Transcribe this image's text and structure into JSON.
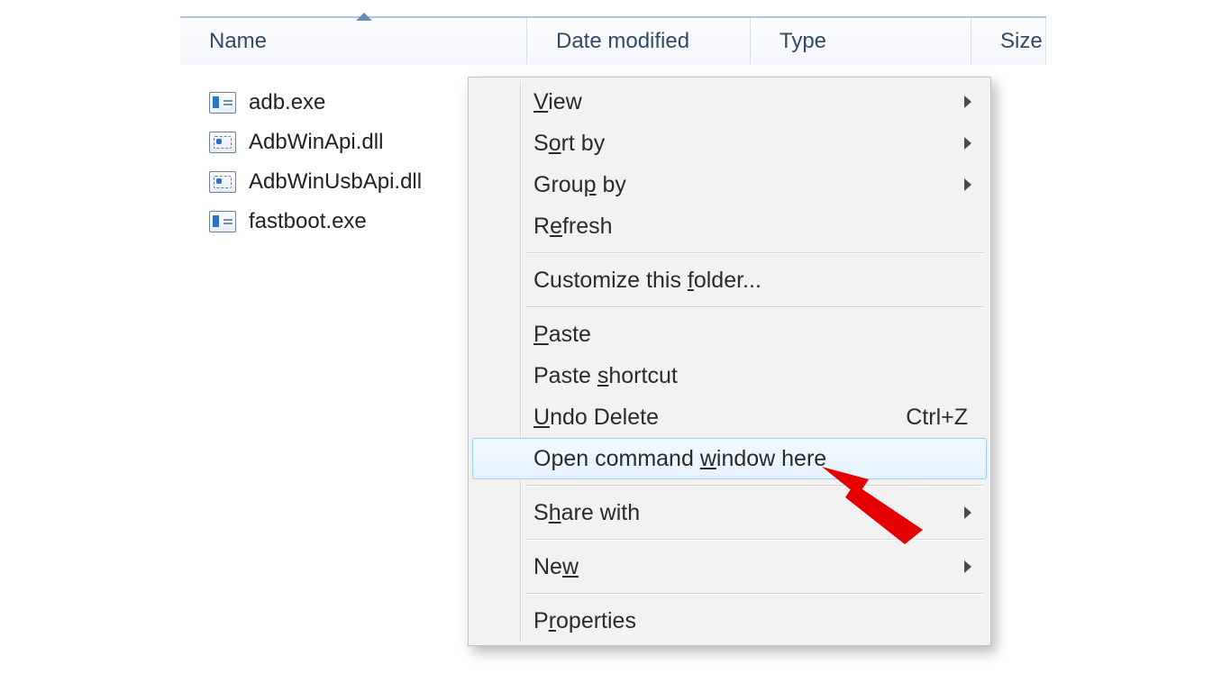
{
  "columns": {
    "name": "Name",
    "date": "Date modified",
    "type": "Type",
    "size": "Size"
  },
  "files": [
    {
      "name": "adb.exe",
      "icon": "exe"
    },
    {
      "name": "AdbWinApi.dll",
      "icon": "dll"
    },
    {
      "name": "AdbWinUsbApi.dll",
      "icon": "dll"
    },
    {
      "name": "fastboot.exe",
      "icon": "exe"
    }
  ],
  "menu": {
    "view": {
      "pre": "",
      "mn": "V",
      "post": "iew"
    },
    "sort": {
      "pre": "S",
      "mn": "o",
      "post": "rt by"
    },
    "group": {
      "pre": "Grou",
      "mn": "p",
      "post": " by"
    },
    "refresh": {
      "pre": "R",
      "mn": "e",
      "post": "fresh"
    },
    "customize": {
      "pre": "Customize this ",
      "mn": "f",
      "post": "older..."
    },
    "paste": {
      "pre": "",
      "mn": "P",
      "post": "aste"
    },
    "paste_shortcut": {
      "pre": "Paste ",
      "mn": "s",
      "post": "hortcut"
    },
    "undo": {
      "pre": "",
      "mn": "U",
      "post": "ndo Delete",
      "accel": "Ctrl+Z"
    },
    "cmd": {
      "pre": "Open command ",
      "mn": "w",
      "post": "indow here"
    },
    "share": {
      "pre": "S",
      "mn": "h",
      "post": "are with"
    },
    "new": {
      "pre": "Ne",
      "mn": "w",
      "post": ""
    },
    "props": {
      "pre": "P",
      "mn": "r",
      "post": "operties"
    }
  }
}
